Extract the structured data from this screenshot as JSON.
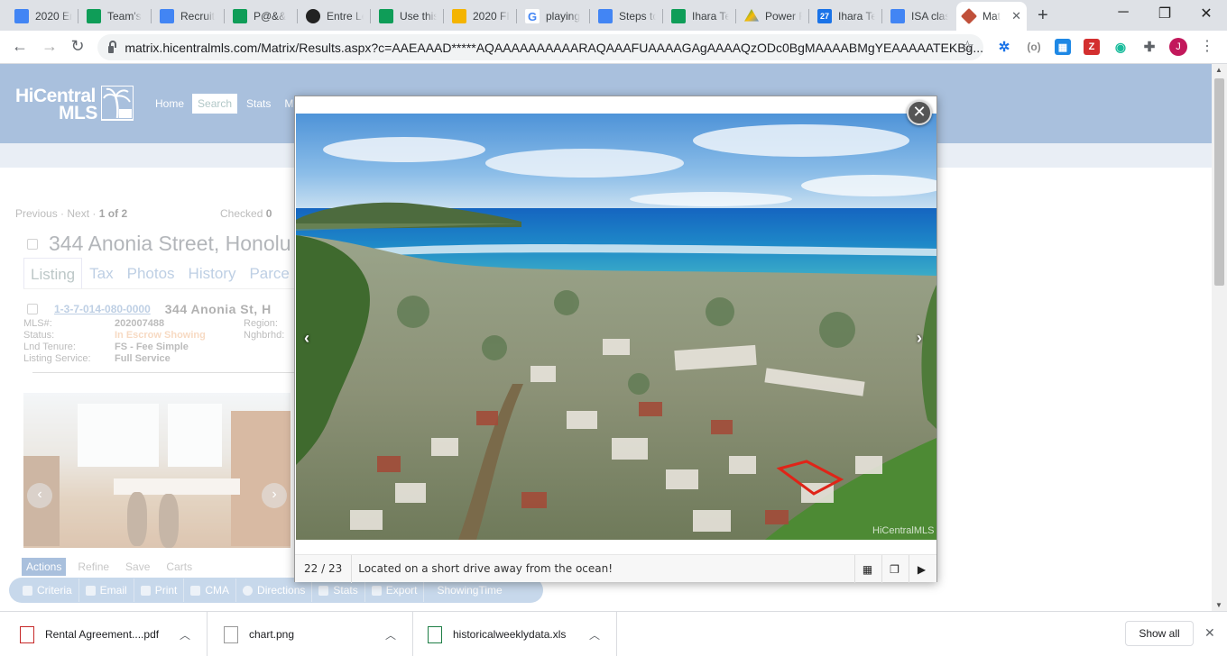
{
  "browser": {
    "tabs": [
      {
        "label": "2020 En",
        "icon": "docs-icon",
        "color": "#4285f4"
      },
      {
        "label": "Team's",
        "icon": "sheets-icon",
        "color": "#0f9d58"
      },
      {
        "label": "Recruit",
        "icon": "docs-icon",
        "color": "#4285f4"
      },
      {
        "label": "P@&&",
        "icon": "sheets-icon",
        "color": "#0f9d58"
      },
      {
        "label": "Entre Le",
        "icon": "app-icon",
        "color": "#222222"
      },
      {
        "label": "Use this",
        "icon": "sheets-icon",
        "color": "#0f9d58"
      },
      {
        "label": "2020 FI",
        "icon": "slides-icon",
        "color": "#f4b400"
      },
      {
        "label": "playing",
        "icon": "google-icon",
        "color": "#ea4335"
      },
      {
        "label": "Steps to",
        "icon": "docs-icon",
        "color": "#4285f4"
      },
      {
        "label": "Ihara Te",
        "icon": "sheets-icon",
        "color": "#0f9d58"
      },
      {
        "label": "Power F",
        "icon": "drive-icon",
        "color": "#fbbc04"
      },
      {
        "label": "Ihara Te",
        "icon": "calendar-icon",
        "color": "#1a73e8"
      },
      {
        "label": "ISA clas",
        "icon": "docs-icon",
        "color": "#4285f4"
      },
      {
        "label": "Mat",
        "icon": "matrix-icon",
        "color": "#c0503a"
      }
    ],
    "calendar_day": "27",
    "url": "matrix.hicentralmls.com/Matrix/Results.aspx?c=AAEAAAD*****AQAAAAAAAAAARAQAAAFUAAAAGAgAAAAQzODc0BgMAAAABMgYEAAAAATEKBg...",
    "profile_initial": "J"
  },
  "site": {
    "logo_line1": "HiCentral",
    "logo_line2": "MLS",
    "nav": [
      "Home",
      "Search",
      "Stats",
      "M"
    ]
  },
  "results": {
    "previous": "Previous",
    "next": "Next",
    "dot": "·",
    "page_current": "1",
    "page_of": "of",
    "page_total": "2",
    "checked_label": "Checked",
    "checked_count": "0",
    "address_title": "344 Anonia Street, Honolu",
    "tabs": [
      "Listing",
      "Tax",
      "Photos",
      "History",
      "Parce"
    ],
    "tmk": "1-3-7-014-080-0000",
    "street": "344 Anonia St, H",
    "fields": [
      {
        "label": "MLS#:",
        "value": "202007488"
      },
      {
        "label": "Status:",
        "value": "In Escrow Showing"
      },
      {
        "label": "Lnd Tenure:",
        "value": "FS - Fee Simple"
      },
      {
        "label": "Listing Service:",
        "value": "Full Service"
      }
    ],
    "fields_right": [
      "Region:",
      "Nghbrhd:"
    ],
    "actions_tabs": [
      "Actions",
      "Refine",
      "Save",
      "Carts"
    ],
    "action_buttons": [
      "Criteria",
      "Email",
      "Print",
      "CMA",
      "Directions",
      "Stats",
      "Export",
      "ShowingTime"
    ]
  },
  "lightbox": {
    "counter": "22 / 23",
    "caption": "Located on a short drive away from the ocean!",
    "watermark": "HiCentralMLS"
  },
  "downloads": {
    "items": [
      {
        "name": "Rental Agreement....pdf",
        "icon": "pdf-icon"
      },
      {
        "name": "chart.png",
        "icon": "image-file-icon"
      },
      {
        "name": "historicalweeklydata.xls",
        "icon": "excel-icon"
      }
    ],
    "show_all": "Show all"
  }
}
